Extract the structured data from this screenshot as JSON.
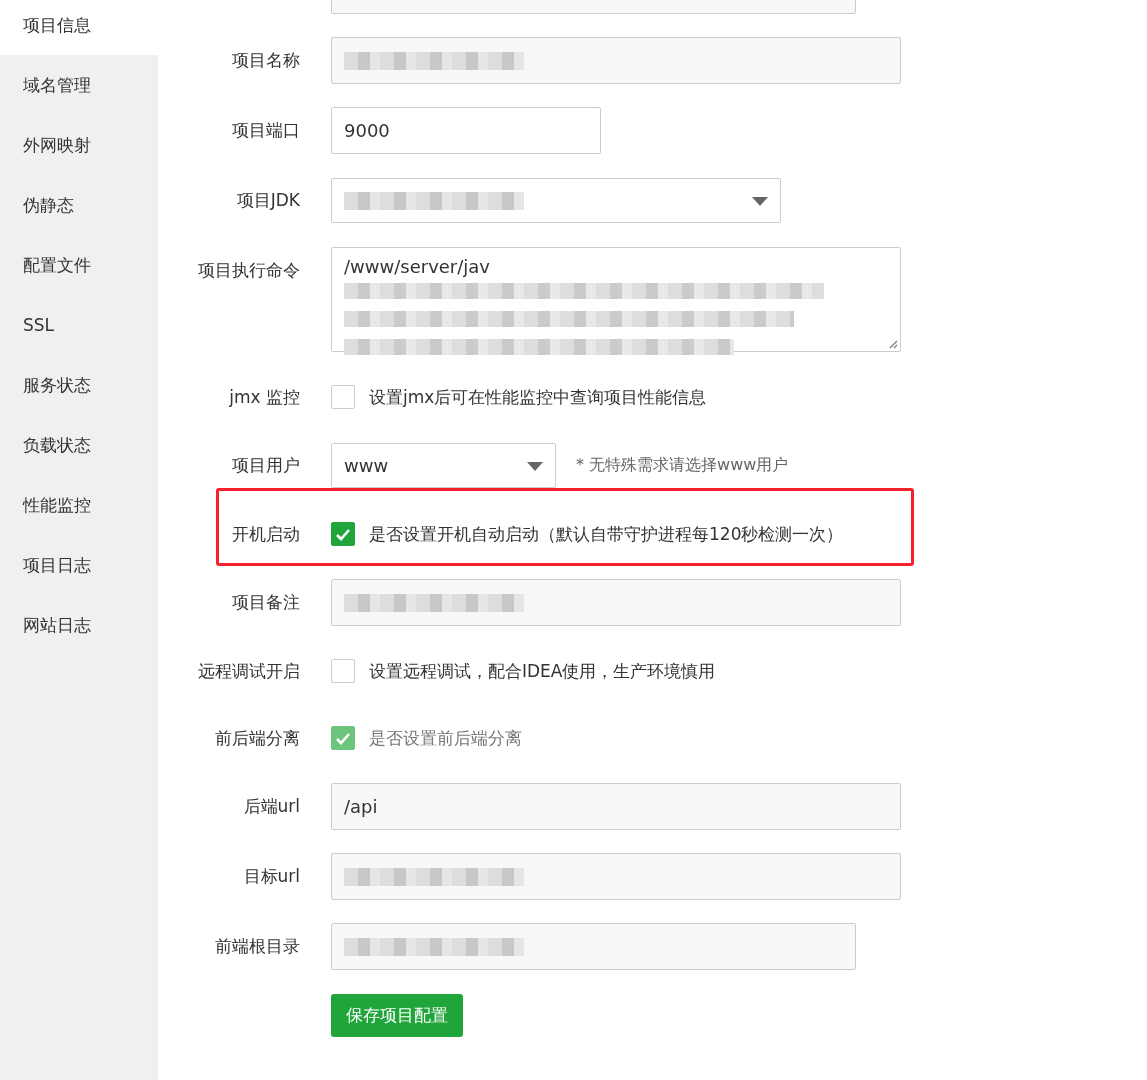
{
  "sidebar": {
    "items": [
      {
        "label": "项目信息",
        "selected": true
      },
      {
        "label": "域名管理",
        "selected": false
      },
      {
        "label": "外网映射",
        "selected": false
      },
      {
        "label": "伪静态",
        "selected": false
      },
      {
        "label": "配置文件",
        "selected": false
      },
      {
        "label": "SSL",
        "selected": false
      },
      {
        "label": "服务状态",
        "selected": false
      },
      {
        "label": "负载状态",
        "selected": false
      },
      {
        "label": "性能监控",
        "selected": false
      },
      {
        "label": "项目日志",
        "selected": false
      },
      {
        "label": "网站日志",
        "selected": false
      }
    ]
  },
  "form": {
    "rows": [
      {
        "kind": "cut"
      },
      {
        "kind": "input",
        "label": "项目名称",
        "redacted": true
      },
      {
        "kind": "input",
        "label": "项目端口",
        "value": "9000"
      },
      {
        "kind": "select",
        "label": "项目JDK",
        "redacted": true
      },
      {
        "kind": "textarea",
        "label": "项目执行命令",
        "value": "/www/server/jav",
        "redacted": true
      },
      {
        "kind": "checkbox",
        "label": "jmx 监控",
        "text": "设置jmx后可在性能监控中查询项目性能信息",
        "checked": false,
        "disabled": false
      },
      {
        "kind": "select",
        "label": "项目用户",
        "value": "www",
        "hint": "* 无特殊需求请选择www用户"
      },
      {
        "kind": "checkbox",
        "label": "开机启动",
        "text": "是否设置开机自动启动（默认自带守护进程每120秒检测一次）",
        "checked": true,
        "disabled": false,
        "highlighted": true
      },
      {
        "kind": "input",
        "label": "项目备注",
        "redacted": true
      },
      {
        "kind": "checkbox",
        "label": "远程调试开启",
        "text": "设置远程调试，配合IDEA使用，生产环境慎用",
        "checked": false,
        "disabled": false
      },
      {
        "kind": "checkbox",
        "label": "前后端分离",
        "text": "是否设置前后端分离",
        "checked": true,
        "disabled": true
      },
      {
        "kind": "input",
        "label": "后端url",
        "value": "/api"
      },
      {
        "kind": "input",
        "label": "目标url",
        "redacted": true
      },
      {
        "kind": "input",
        "label": "前端根目录",
        "redacted": true
      }
    ],
    "save_button": "保存项目配置"
  }
}
